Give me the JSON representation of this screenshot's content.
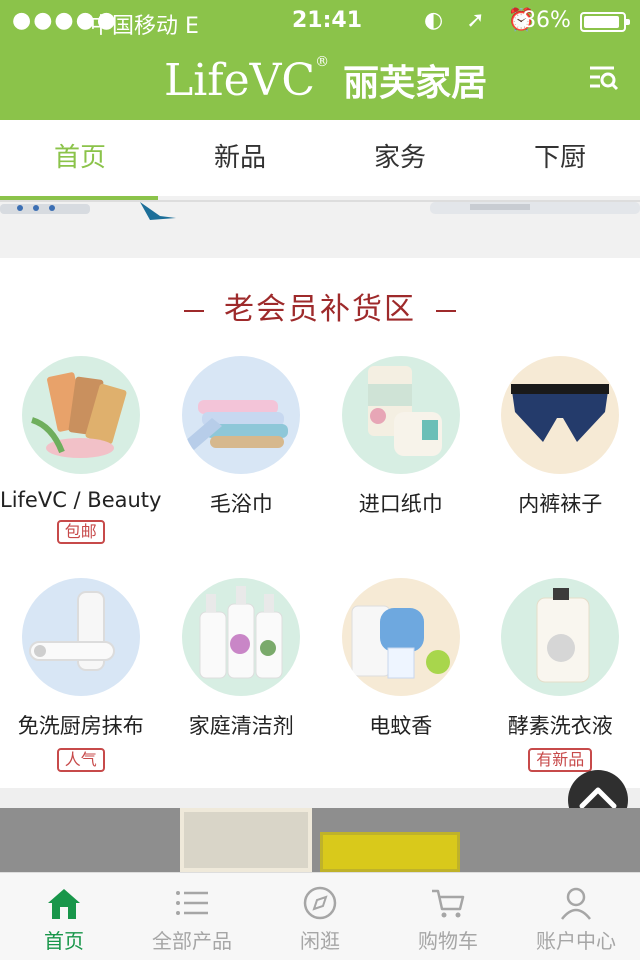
{
  "status_bar": {
    "signal": "●●●●●",
    "carrier": "中国移动  E",
    "time": "21:41",
    "icons": "◐ ➚ ⏰",
    "battery": "86%"
  },
  "header": {
    "logo_en": "LifeVC",
    "logo_reg": "®",
    "logo_cn": "丽芙家居"
  },
  "tabs": [
    {
      "label": "首页"
    },
    {
      "label": "新品"
    },
    {
      "label": "家务"
    },
    {
      "label": "下厨"
    }
  ],
  "section": {
    "title": "老会员补货区"
  },
  "products": [
    {
      "label": "LifeVC / Beauty",
      "badge": "包邮"
    },
    {
      "label": "毛浴巾",
      "badge": ""
    },
    {
      "label": "进口纸巾",
      "badge": ""
    },
    {
      "label": "内裤袜子",
      "badge": ""
    },
    {
      "label": "免洗厨房抹布",
      "badge": "人气"
    },
    {
      "label": "家庭清洁剂",
      "badge": ""
    },
    {
      "label": "电蚊香",
      "badge": ""
    },
    {
      "label": "酵素洗衣液",
      "badge": "有新品"
    }
  ],
  "bottom_nav": [
    {
      "label": "首页",
      "icon": "home-icon"
    },
    {
      "label": "全部产品",
      "icon": "list-icon"
    },
    {
      "label": "闲逛",
      "icon": "compass-icon"
    },
    {
      "label": "购物车",
      "icon": "cart-icon"
    },
    {
      "label": "账户中心",
      "icon": "user-icon"
    }
  ],
  "colors": {
    "brand_green": "#8bc34a",
    "nav_active": "#18964a",
    "section_title": "#9e2a2b",
    "badge": "#c74a4a"
  }
}
